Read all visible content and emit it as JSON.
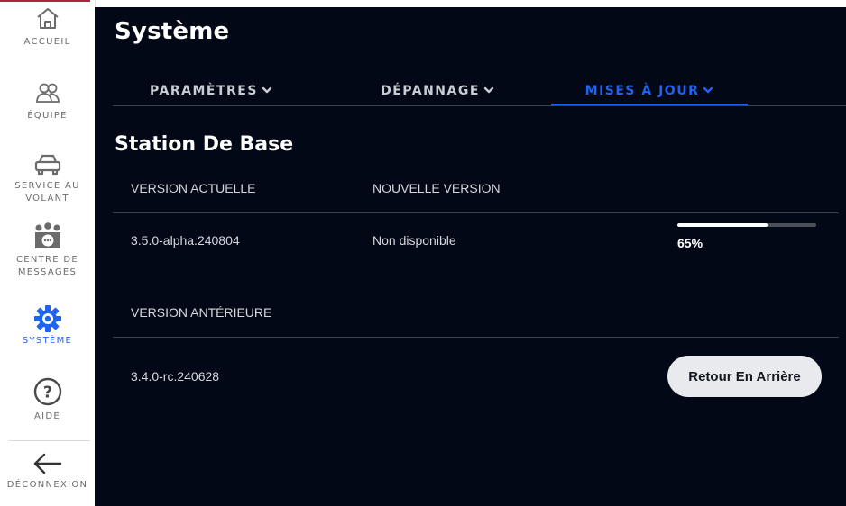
{
  "sidebar": {
    "items": [
      {
        "label": "ACCUEIL",
        "icon": "home-icon"
      },
      {
        "label": "ÉQUIPE",
        "icon": "team-icon"
      },
      {
        "label": "SERVICE AU VOLANT",
        "icon": "car-icon"
      },
      {
        "label": "CENTRE DE MESSAGES",
        "icon": "message-center-icon"
      },
      {
        "label": "SYSTÈME",
        "icon": "gear-icon",
        "active": true
      },
      {
        "label": "AIDE",
        "icon": "help-icon"
      }
    ],
    "logout": {
      "label": "DÉCONNEXION",
      "icon": "arrow-left-icon"
    }
  },
  "header": {
    "title": "Système"
  },
  "tabs": [
    {
      "label": "PARAMÈTRES",
      "icon": "chevron-down-icon"
    },
    {
      "label": "DÉPANNAGE",
      "icon": "chevron-down-icon"
    },
    {
      "label": "MISES À JOUR",
      "icon": "chevron-down-icon",
      "active": true
    }
  ],
  "section": {
    "title": "Station De Base",
    "current_header": "VERSION ACTUELLE",
    "new_header": "NOUVELLE VERSION",
    "current_version": "3.5.0-alpha.240804",
    "new_version": "Non disponible",
    "progress": {
      "percent": 65,
      "label": "65%"
    },
    "previous_header": "VERSION ANTÉRIEURE",
    "previous_version": "3.4.0-rc.240628",
    "rollback_label": "Retour En Arrière"
  },
  "colors": {
    "accent": "#1f63f2",
    "background": "#030816",
    "sidebar_bg": "#ffffff",
    "top_accent": "#b0233d"
  }
}
